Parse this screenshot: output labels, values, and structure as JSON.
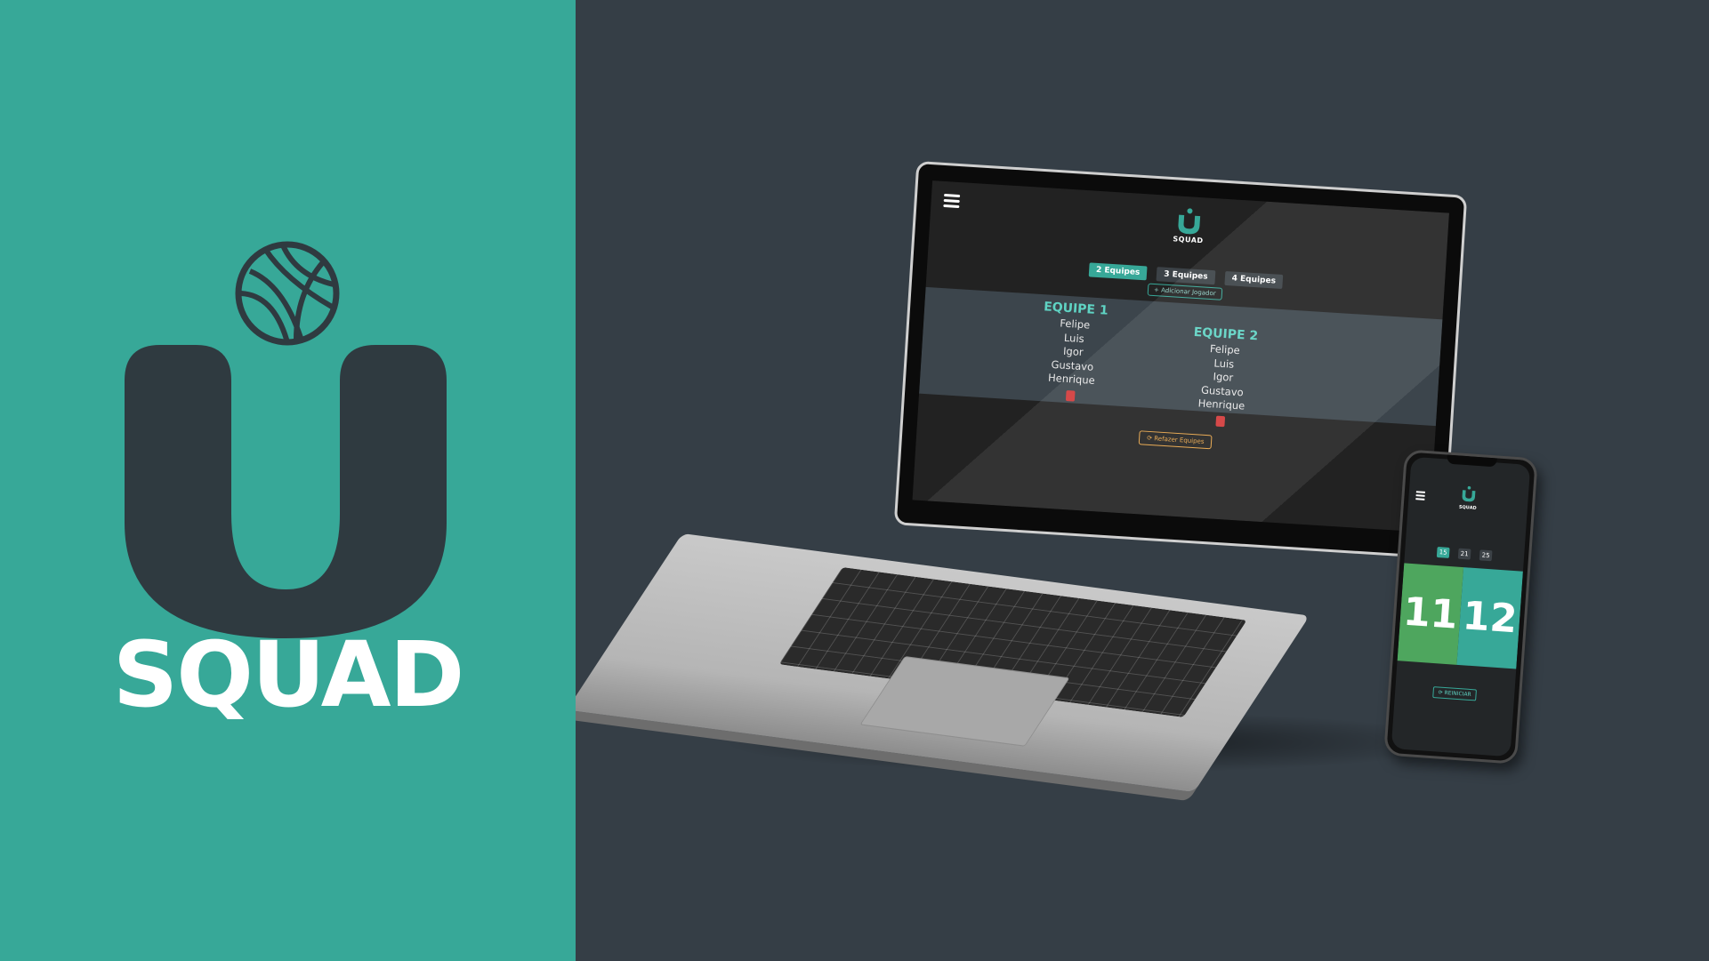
{
  "brand": {
    "wordmark": "SQUAD",
    "colors": {
      "teal": "#37a898",
      "dark": "#353e46",
      "white": "#ffffff"
    },
    "icons": [
      "volleyball-icon",
      "u-letter-logo"
    ]
  },
  "laptop_app": {
    "logo_word": "SQUAD",
    "menu_icon": "hamburger-icon",
    "tabs": [
      {
        "label": "2 Equipes",
        "active": true
      },
      {
        "label": "3 Equipes",
        "active": false
      },
      {
        "label": "4 Equipes",
        "active": false
      }
    ],
    "add_player_label": "+ Adicionar Jogador",
    "teams": [
      {
        "title": "EQUIPE 1",
        "players": [
          "Felipe",
          "Luis",
          "Igor",
          "Gustavo",
          "Henrique"
        ]
      },
      {
        "title": "EQUIPE 2",
        "players": [
          "Felipe",
          "Luis",
          "Igor",
          "Gustavo",
          "Henrique"
        ]
      }
    ],
    "redo_label": "⟳ Refazer Equipes",
    "colors": {
      "accent": "#37a898",
      "danger": "#d23a3a",
      "warning": "#e8a548"
    }
  },
  "phone_app": {
    "logo_word": "SQUAD",
    "menu_icon": "hamburger-icon",
    "score_limits": [
      {
        "label": "15",
        "active": true
      },
      {
        "label": "21",
        "active": false
      },
      {
        "label": "25",
        "active": false
      }
    ],
    "score_left": "11",
    "score_right": "12",
    "reset_label": "⟳ REINICIAR",
    "colors": {
      "left_team": "#4ea65e",
      "right_team": "#37a898"
    }
  }
}
